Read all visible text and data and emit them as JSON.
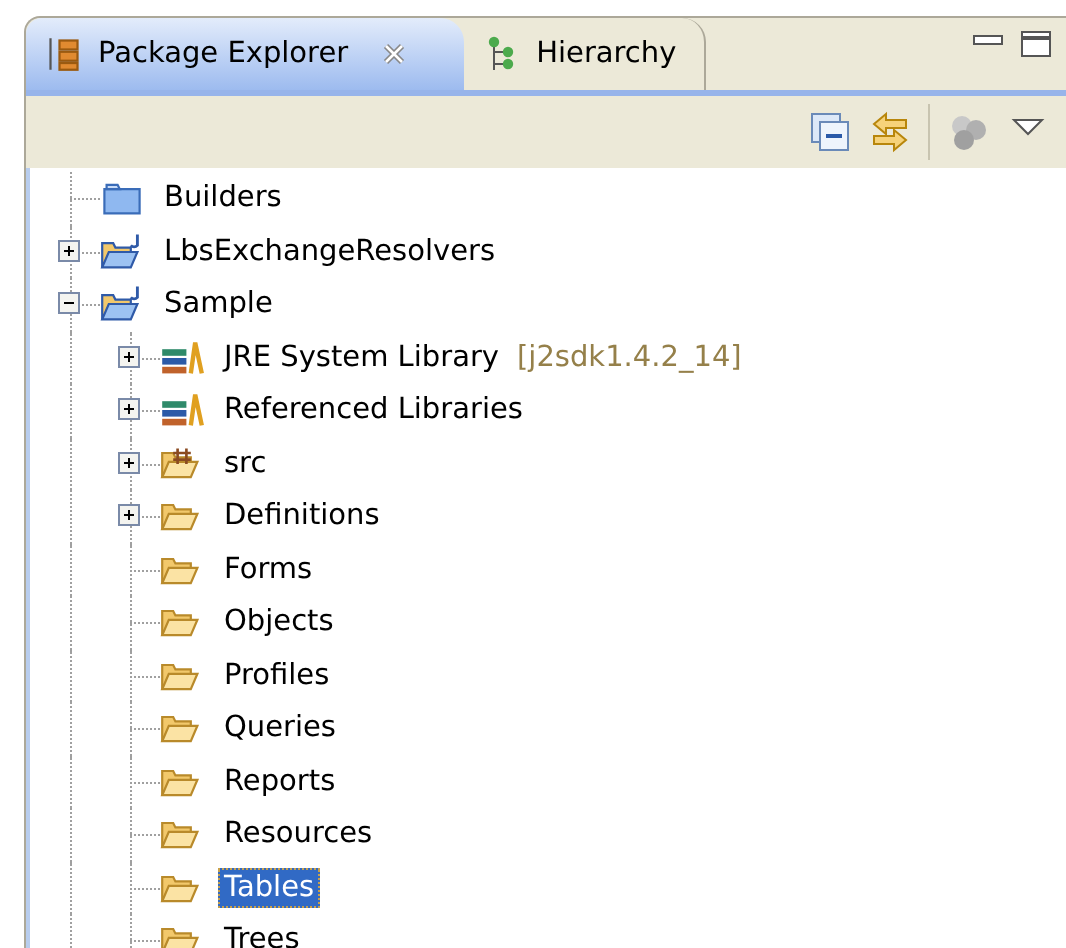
{
  "tabs": [
    {
      "label": "Package Explorer",
      "selected": true,
      "kind": "packages"
    },
    {
      "label": "Hierarchy",
      "selected": false,
      "kind": "hierarchy"
    }
  ],
  "tree": [
    {
      "label": "Builders",
      "kind": "folder-blue",
      "expandable": false,
      "expanded": false,
      "selected": false
    },
    {
      "label": "LbsExchangeResolvers",
      "kind": "project",
      "expandable": true,
      "expanded": false,
      "selected": false
    },
    {
      "label": "Sample",
      "kind": "project",
      "expandable": true,
      "expanded": true,
      "selected": false,
      "children": [
        {
          "label": "JRE System Library",
          "decoration": "[j2sdk1.4.2_14]",
          "kind": "library",
          "expandable": true,
          "expanded": false,
          "selected": false
        },
        {
          "label": "Referenced Libraries",
          "kind": "library",
          "expandable": true,
          "expanded": false,
          "selected": false
        },
        {
          "label": "src",
          "kind": "package-folder",
          "expandable": true,
          "expanded": false,
          "selected": false
        },
        {
          "label": "Definitions",
          "kind": "folder",
          "expandable": true,
          "expanded": false,
          "selected": false
        },
        {
          "label": "Forms",
          "kind": "folder",
          "expandable": false,
          "expanded": false,
          "selected": false
        },
        {
          "label": "Objects",
          "kind": "folder",
          "expandable": false,
          "expanded": false,
          "selected": false
        },
        {
          "label": "Profiles",
          "kind": "folder",
          "expandable": false,
          "expanded": false,
          "selected": false
        },
        {
          "label": "Queries",
          "kind": "folder",
          "expandable": false,
          "expanded": false,
          "selected": false
        },
        {
          "label": "Reports",
          "kind": "folder",
          "expandable": false,
          "expanded": false,
          "selected": false
        },
        {
          "label": "Resources",
          "kind": "folder",
          "expandable": false,
          "expanded": false,
          "selected": false
        },
        {
          "label": "Tables",
          "kind": "folder",
          "expandable": false,
          "expanded": false,
          "selected": true
        },
        {
          "label": "Trees",
          "kind": "folder",
          "expandable": false,
          "expanded": false,
          "selected": false
        }
      ]
    }
  ]
}
